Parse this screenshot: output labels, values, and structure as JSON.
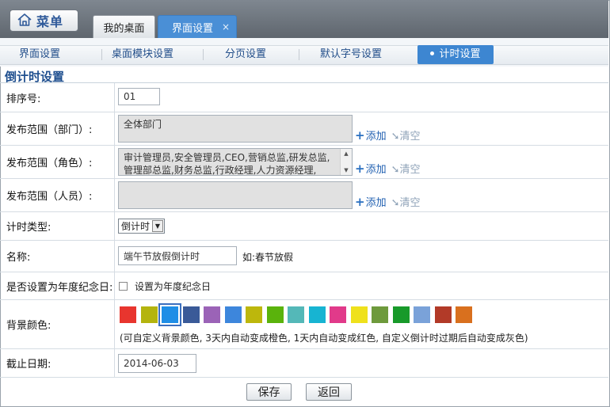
{
  "header": {
    "menu_label": "菜单",
    "tabs": [
      {
        "label": "我的桌面"
      },
      {
        "label": "界面设置",
        "close": "×"
      }
    ]
  },
  "subnav": {
    "items": [
      "界面设置",
      "桌面模块设置",
      "分页设置",
      "默认字号设置",
      "计时设置"
    ],
    "active_index": 4
  },
  "section_title": "倒计时设置",
  "form": {
    "sort": {
      "label": "排序号:",
      "value": "01"
    },
    "dept": {
      "label": "发布范围（部门）:",
      "value": "全体部门"
    },
    "role": {
      "label": "发布范围（角色）:",
      "value": "审计管理员,安全管理员,CEO,营销总监,研发总监,管理部总监,财务总监,行政经理,人力资源经理,"
    },
    "person": {
      "label": "发布范围（人员）:",
      "value": ""
    },
    "actions": {
      "add": "添加",
      "clear": "清空"
    },
    "timer_type": {
      "label": "计时类型:",
      "value": "倒计时"
    },
    "name": {
      "label": "名称:",
      "value": "端午节放假倒计时",
      "example": "如:春节放假"
    },
    "anniversary": {
      "label": "是否设置为年度纪念日:",
      "checkbox_label": "设置为年度纪念日",
      "checked": false
    },
    "bgcolor": {
      "label": "背景颜色:",
      "colors": [
        "#e8352e",
        "#b4b40e",
        "#1f8ee6",
        "#3a5a98",
        "#9b63b7",
        "#3d86dc",
        "#bdb70c",
        "#5ab30c",
        "#54b8b8",
        "#17b4d2",
        "#e13a8a",
        "#efe11c",
        "#6e9a3c",
        "#189a2a",
        "#7aa2d9",
        "#b23a28",
        "#d9701e"
      ],
      "selected_index": 2,
      "hint": "(可自定义背景颜色, 3天内自动变成橙色, 1天内自动变成红色, 自定义倒计时过期后自动变成灰色)"
    },
    "deadline": {
      "label": "截止日期:",
      "value": "2014-06-03"
    }
  },
  "buttons": {
    "save": "保存",
    "back": "返回"
  }
}
